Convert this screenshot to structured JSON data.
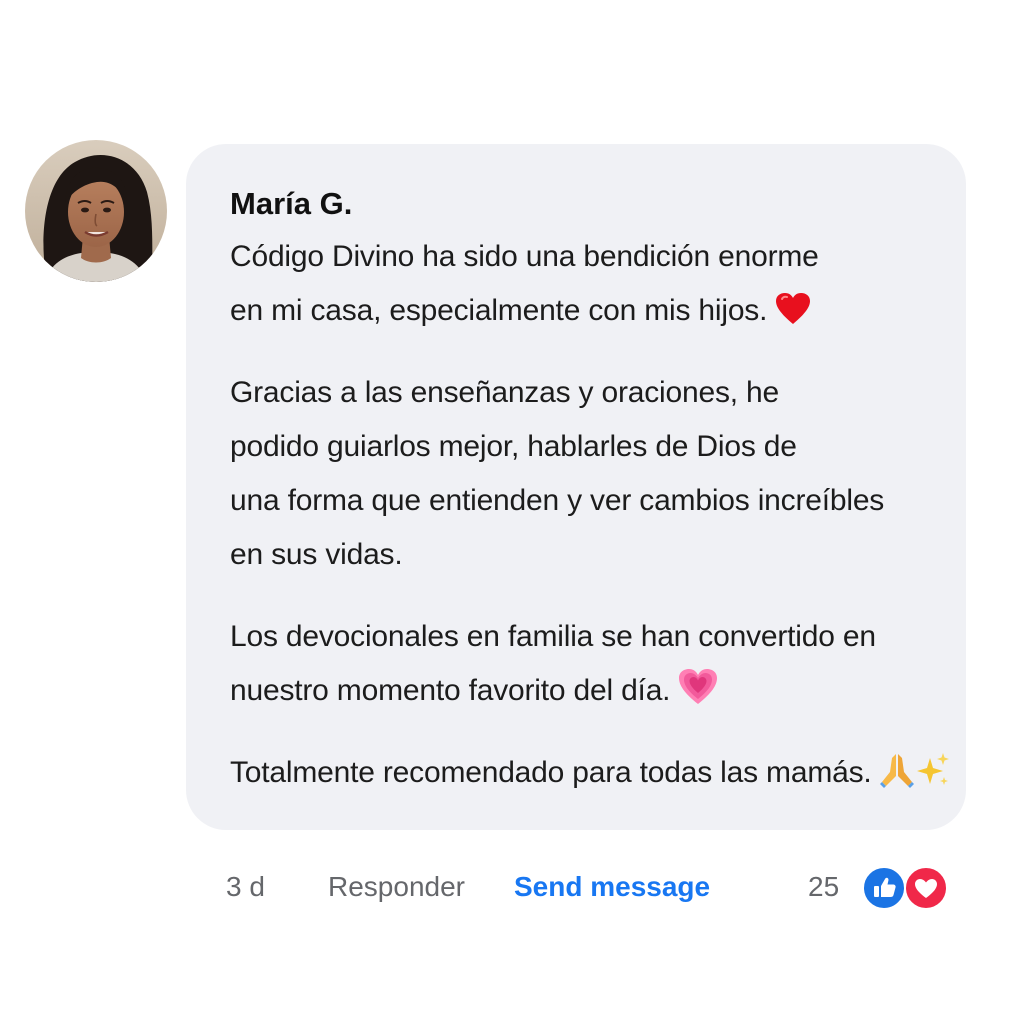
{
  "comment": {
    "author": "María G.",
    "paragraphs": [
      {
        "lines": [
          "Código Divino ha sido una bendición enorme",
          "en mi casa, especialmente con mis hijos."
        ],
        "emoji": [
          "red-heart-icon"
        ]
      },
      {
        "lines": [
          "Gracias a las enseñanzas y oraciones, he",
          "podido guiarlos mejor, hablarles de Dios de",
          "una forma que entienden y ver cambios increíbles",
          "en sus vidas."
        ],
        "emoji": []
      },
      {
        "lines": [
          "Los devocionales en familia se han convertido en",
          "nuestro momento favorito del día."
        ],
        "emoji": [
          "growing-heart-icon"
        ]
      },
      {
        "lines": [
          "Totalmente recomendado para todas las mamás."
        ],
        "emoji": [
          "praying-hands-icon",
          "sparkles-icon"
        ]
      }
    ]
  },
  "actions": {
    "time": "3 d",
    "reply_label": "Responder",
    "send_label": "Send message",
    "reaction_count": "25",
    "reactions": [
      "like-icon",
      "love-icon"
    ]
  },
  "colors": {
    "bubble_bg": "#f0f1f5",
    "link_blue": "#1877f2",
    "meta_gray": "#65676b",
    "like_blue": "#1b74e4",
    "love_red": "#f02849"
  }
}
